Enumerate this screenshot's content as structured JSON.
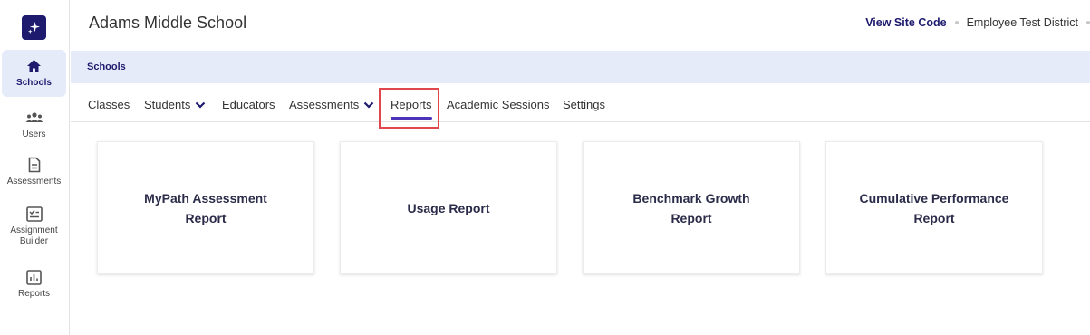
{
  "sidebar": {
    "logo_icon": "sparkle-icon",
    "items": [
      {
        "label": "Schools",
        "icon": "home-icon",
        "active": true
      },
      {
        "label": "Users",
        "icon": "users-icon"
      },
      {
        "label": "Assessments",
        "icon": "document-icon"
      },
      {
        "label": "Assignment Builder",
        "icon": "checklist-icon"
      },
      {
        "label": "Reports",
        "icon": "bar-chart-icon"
      }
    ]
  },
  "header": {
    "title": "Adams Middle School",
    "site_code_link": "View Site Code",
    "district": "Employee Test District"
  },
  "breadcrumb": {
    "label": "Schools"
  },
  "tabs": [
    {
      "label": "Classes"
    },
    {
      "label": "Students",
      "dropdown": true
    },
    {
      "label": "Educators"
    },
    {
      "label": "Assessments",
      "dropdown": true
    },
    {
      "label": "Reports",
      "active": true
    },
    {
      "label": "Academic Sessions"
    },
    {
      "label": "Settings"
    }
  ],
  "cards": [
    {
      "label": "MyPath Assessment Report"
    },
    {
      "label": "Usage Report"
    },
    {
      "label": "Benchmark Growth Report"
    },
    {
      "label": "Cumulative Performance Report"
    }
  ],
  "colors": {
    "brand": "#1e1b6e",
    "band": "#e6ebfa",
    "active_underline": "#4b34b8",
    "highlight_border": "#e0474c"
  }
}
